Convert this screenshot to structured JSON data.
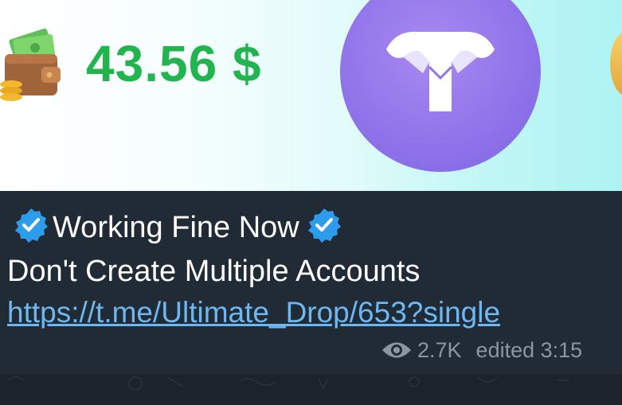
{
  "banner": {
    "amount": "43.56 $",
    "wallet_icon": "wallet-icon",
    "logo_icon": "ultimate-drop-logo-icon",
    "colors": {
      "amount": "#22b54f",
      "logo_circle": "#9174ea"
    }
  },
  "message": {
    "title": "Working Fine Now",
    "subtitle": "Don't Create Multiple Accounts",
    "link": "https://t.me/Ultimate_Drop/653?single",
    "verified_icon": "verified-check-icon",
    "views_icon": "eye-icon",
    "views": "2.7K",
    "edited_label": "edited",
    "time": "3:15",
    "colors": {
      "link": "#6fb7f0",
      "text": "#ffffff",
      "meta": "#8c96a0",
      "badge": "#2d9cea"
    }
  }
}
